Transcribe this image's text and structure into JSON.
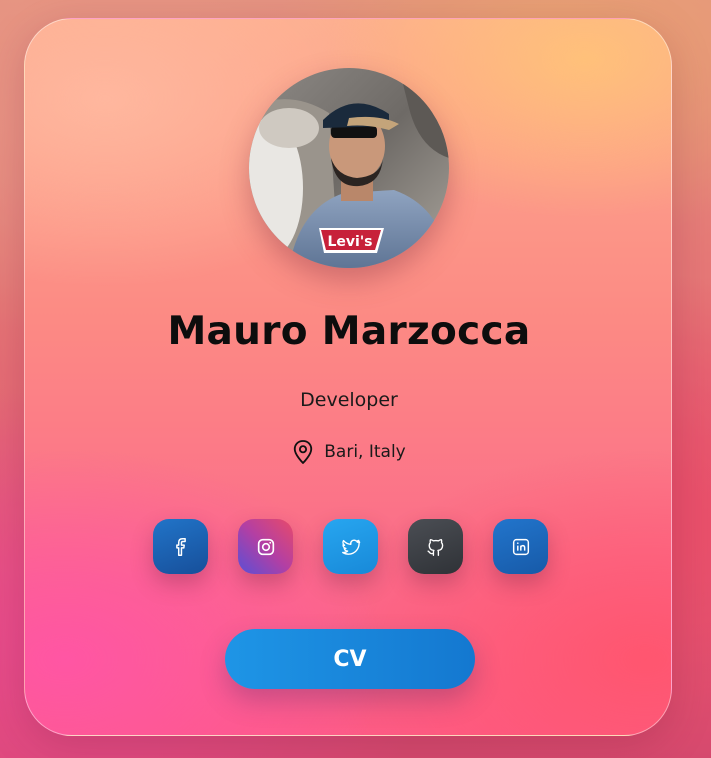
{
  "profile": {
    "name": "Mauro Marzocca",
    "role": "Developer",
    "location": "Bari, Italy",
    "avatar": "avatar-photo",
    "location_icon": "map-pin-icon"
  },
  "socials": [
    {
      "name": "facebook",
      "icon": "facebook-icon",
      "color": "#1b5fae"
    },
    {
      "name": "instagram",
      "icon": "instagram-icon",
      "color": "#8a3ec0"
    },
    {
      "name": "twitter",
      "icon": "twitter-icon",
      "color": "#1d9be8"
    },
    {
      "name": "github",
      "icon": "github-icon",
      "color": "#3c3f44"
    },
    {
      "name": "linkedin",
      "icon": "linkedin-icon",
      "color": "#1b64b8"
    }
  ],
  "cv_button": {
    "label": "CV",
    "color": "#1a88dd"
  }
}
